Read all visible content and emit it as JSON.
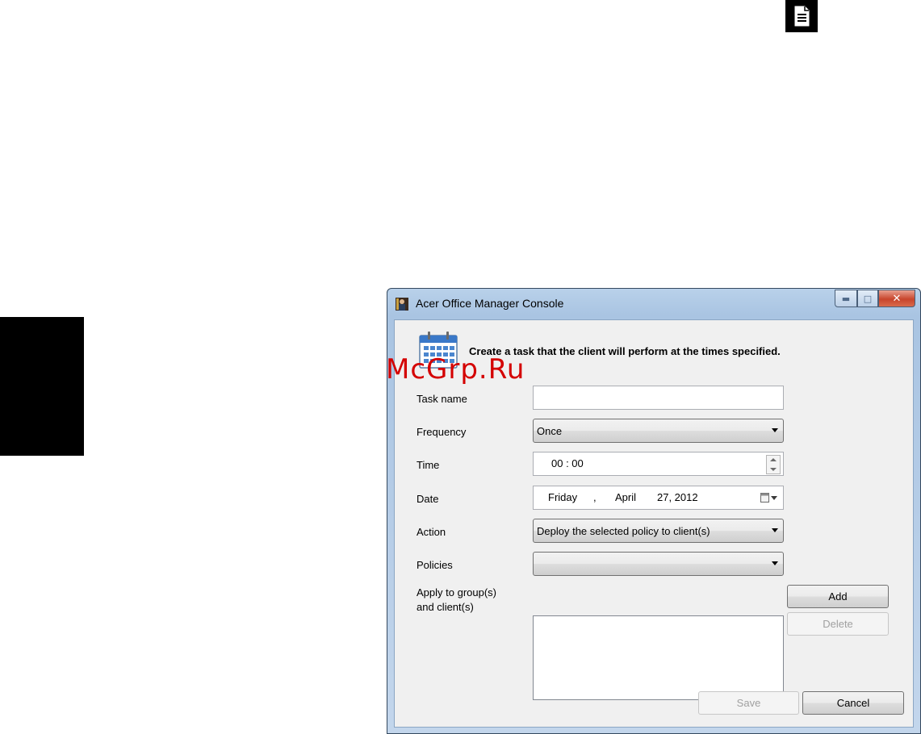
{
  "window": {
    "title": "Acer Office Manager Console"
  },
  "watermark": "McGrp.Ru",
  "header": {
    "text": "Create a task that the client will perform at the times specified."
  },
  "form": {
    "task_name_label": "Task name",
    "task_name_value": "",
    "frequency_label": "Frequency",
    "frequency_value": "Once",
    "time_label": "Time",
    "time_value": "00 :  00",
    "date_label": "Date",
    "date_day": "Friday",
    "date_sep": ",",
    "date_month": "April",
    "date_rest": "27, 2012",
    "action_label": "Action",
    "action_value": "Deploy the selected policy to client(s)",
    "policies_label": "Policies",
    "policies_value": "",
    "apply_label_line1": "Apply to group(s)",
    "apply_label_line2": "and client(s)"
  },
  "buttons": {
    "add": "Add",
    "delete": "Delete",
    "save": "Save",
    "cancel": "Cancel"
  },
  "icons": {
    "page": "document-icon",
    "app": "app-icon",
    "calendar": "calendar-icon"
  }
}
